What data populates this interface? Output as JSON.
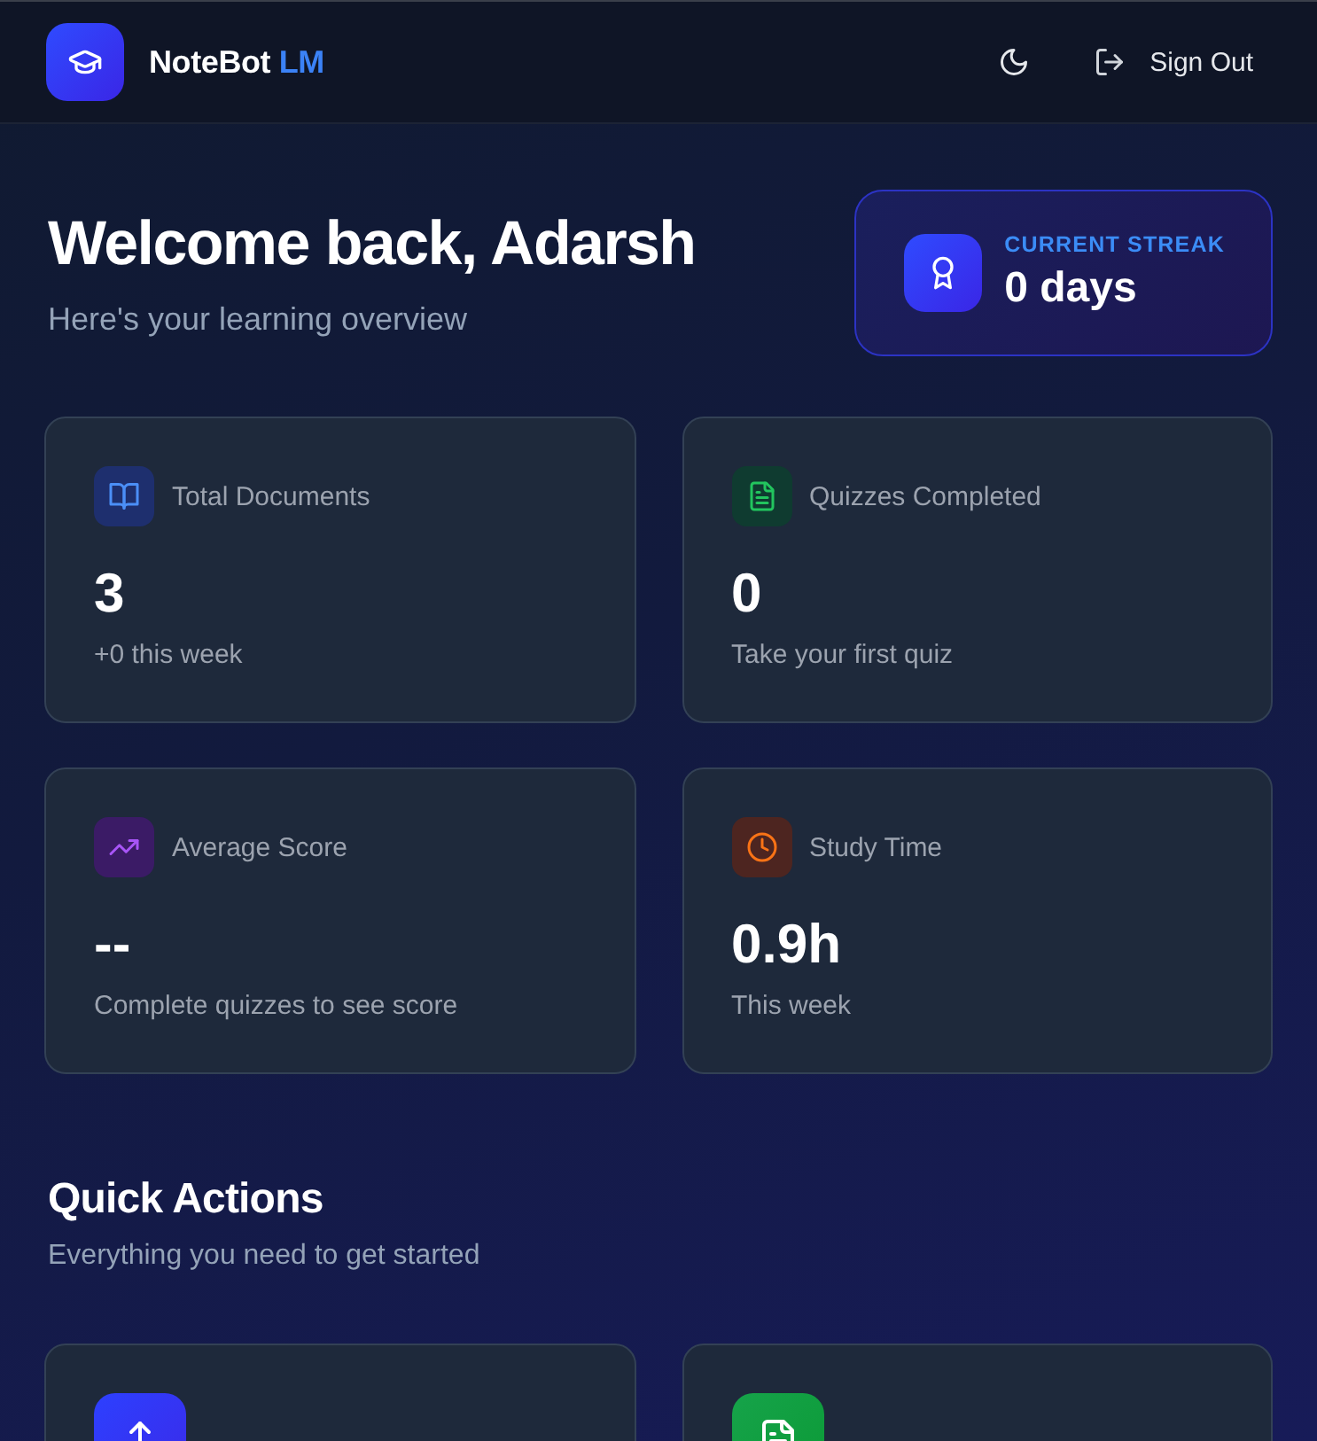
{
  "header": {
    "brand_name": "NoteBot",
    "brand_suffix": "LM",
    "sign_out": "Sign Out"
  },
  "welcome": {
    "title": "Welcome back, Adarsh",
    "subtitle": "Here's your learning overview"
  },
  "streak": {
    "label": "CURRENT STREAK",
    "value": "0 days"
  },
  "stats": [
    {
      "kind": "documents",
      "label": "Total Documents",
      "value": "3",
      "note": "+0 this week"
    },
    {
      "kind": "quizzes",
      "label": "Quizzes Completed",
      "value": "0",
      "note": "Take your first quiz"
    },
    {
      "kind": "score",
      "label": "Average Score",
      "value": "--",
      "note": "Complete quizzes to see score"
    },
    {
      "kind": "time",
      "label": "Study Time",
      "value": "0.9h",
      "note": "This week"
    }
  ],
  "quick_actions": {
    "title": "Quick Actions",
    "subtitle": "Everything you need to get started",
    "items": [
      {
        "kind": "upload"
      },
      {
        "kind": "quiz"
      }
    ]
  }
}
